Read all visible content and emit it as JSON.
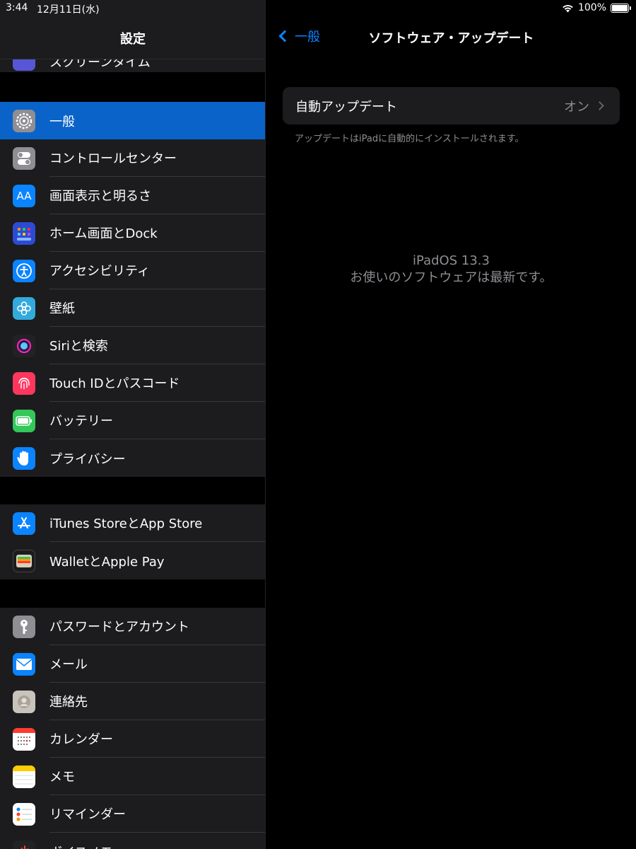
{
  "status": {
    "time": "3:44",
    "date": "12月11日(水)",
    "battery": "100%"
  },
  "sidebar": {
    "title": "設定",
    "partial_label": "スクリーンタイム",
    "group1": [
      {
        "label": "一般",
        "icon": "gear-icon",
        "color": "#8e8e93",
        "selected": true
      },
      {
        "label": "コントロールセンター",
        "icon": "toggles-icon",
        "color": "#8e8e93"
      },
      {
        "label": "画面表示と明るさ",
        "icon": "text-size-icon",
        "color": "#0a84ff"
      },
      {
        "label": "ホーム画面とDock",
        "icon": "home-grid-icon",
        "color": "#2c4bd4"
      },
      {
        "label": "アクセシビリティ",
        "icon": "accessibility-icon",
        "color": "#0a84ff"
      },
      {
        "label": "壁紙",
        "icon": "flower-icon",
        "color": "#34aadc"
      },
      {
        "label": "Siriと検索",
        "icon": "siri-icon",
        "color": "#222"
      },
      {
        "label": "Touch IDとパスコード",
        "icon": "fingerprint-icon",
        "color": "#ff375f"
      },
      {
        "label": "バッテリー",
        "icon": "battery-icon",
        "color": "#34c759"
      },
      {
        "label": "プライバシー",
        "icon": "hand-icon",
        "color": "#0a84ff"
      }
    ],
    "group2": [
      {
        "label": "iTunes StoreとApp Store",
        "icon": "app-store-icon",
        "color": "#0a84ff"
      },
      {
        "label": "WalletとApple Pay",
        "icon": "wallet-icon",
        "color": "#1c1c1e"
      }
    ],
    "group3": [
      {
        "label": "パスワードとアカウント",
        "icon": "key-icon",
        "color": "#8e8e93"
      },
      {
        "label": "メール",
        "icon": "mail-icon",
        "color": "#0a84ff"
      },
      {
        "label": "連絡先",
        "icon": "contacts-icon",
        "color": "#c8c4bc"
      },
      {
        "label": "カレンダー",
        "icon": "calendar-icon",
        "color": "#ffffff"
      },
      {
        "label": "メモ",
        "icon": "notes-icon",
        "color": "#ffffff"
      },
      {
        "label": "リマインダー",
        "icon": "reminders-icon",
        "color": "#ffffff"
      },
      {
        "label": "ボイスメモ",
        "icon": "voice-memo-icon",
        "color": "#222"
      }
    ]
  },
  "detail": {
    "back_label": "一般",
    "title": "ソフトウェア・アップデート",
    "auto_update_label": "自動アップデート",
    "auto_update_value": "オン",
    "footnote": "アップデートはiPadに自動的にインストールされます。",
    "os_version": "iPadOS 13.3",
    "status_message": "お使いのソフトウェアは最新です。"
  }
}
